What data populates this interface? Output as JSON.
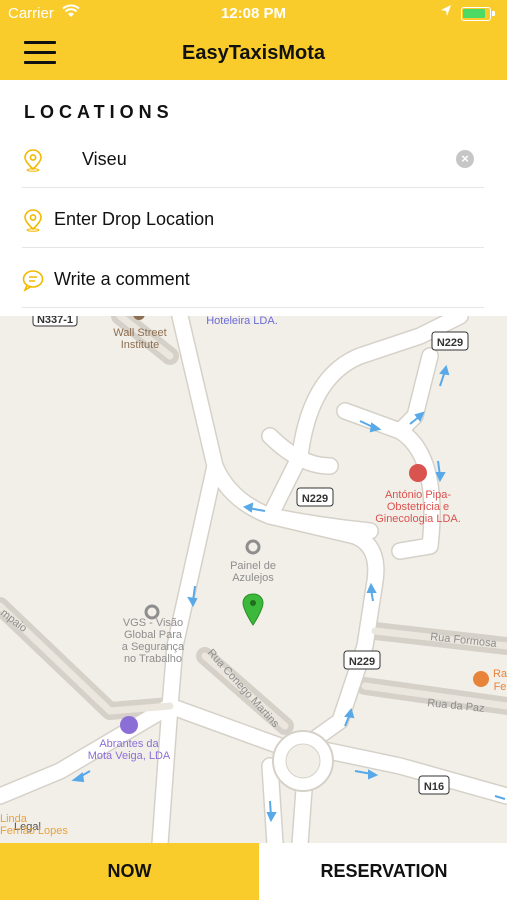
{
  "status_bar": {
    "carrier": "Carrier",
    "time": "12:08 PM"
  },
  "nav": {
    "title": "EasyTaxisMota",
    "menu_icon": "hamburger-menu-icon"
  },
  "locations": {
    "title": "LOCATIONS",
    "pickup": {
      "value": "Viseu",
      "icon": "location-pin-icon"
    },
    "drop": {
      "placeholder": "Enter Drop Location",
      "icon": "location-pin-icon"
    },
    "comment": {
      "placeholder": "Write a comment",
      "icon": "chat-bubble-icon"
    }
  },
  "map": {
    "road_labels": [
      "N337-1",
      "N229",
      "N229",
      "N229",
      "N16",
      "Rua Formosa",
      "Rua da Paz",
      "Rua Conego Martins",
      "Hotelera LDA."
    ],
    "places": {
      "wall_street": [
        "Wall Street",
        "Institute"
      ],
      "hotel": "Hoteleira LDA.",
      "antonio": [
        "António Pipa-",
        "Obstetrícia e",
        "Ginecologia LDA."
      ],
      "painel": [
        "Painel de",
        "Azulejos"
      ],
      "vgs": [
        "VGS - Visão",
        "Global Para",
        "a Segurança",
        "no Trabalho"
      ],
      "abrantes": [
        "Abrantes da",
        "Mota Veiga, LDA"
      ],
      "legal": "Legal",
      "fernao": "Fernão Lopes",
      "linda": "Linda",
      "ra": "Ra",
      "fe": "Fe",
      "pio": "mpaio"
    },
    "colors": {
      "road": "#ffffff",
      "road_edge": "#d6d1c8",
      "arrow": "#59a9e8",
      "pin": "#3cb93a",
      "poi_brown": "#8d6e50",
      "poi_gray": "#8e8e8e",
      "poi_red": "#d9534f",
      "poi_purple": "#8b6fd6"
    }
  },
  "bottom": {
    "now_label": "NOW",
    "reservation_label": "RESERVATION"
  },
  "theme": {
    "accent": "#f9cc2c"
  }
}
